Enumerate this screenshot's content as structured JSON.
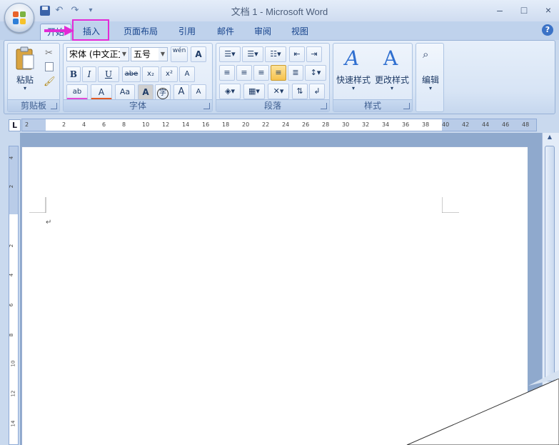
{
  "window": {
    "title": "文档 1 - Microsoft Word",
    "minimize": "–",
    "maximize": "□",
    "close": "×"
  },
  "qat": {
    "undo": "↶",
    "redo": "↷",
    "more": "▾"
  },
  "tabs": [
    {
      "label": "开始"
    },
    {
      "label": "插入"
    },
    {
      "label": "页面布局"
    },
    {
      "label": "引用"
    },
    {
      "label": "邮件"
    },
    {
      "label": "审阅"
    },
    {
      "label": "视图"
    }
  ],
  "help": "?",
  "clipboard": {
    "paste": "粘贴",
    "label": "剪贴板"
  },
  "font": {
    "font_name": "宋体 (中文正文)",
    "font_size": "五号",
    "wen": "wén",
    "a_box": "A",
    "bold": "B",
    "italic": "I",
    "underline": "U",
    "strike": "abe",
    "sub": "x₂",
    "sup": "x²",
    "clear": "A",
    "highlight": "ab",
    "color": "A",
    "case": "Aa",
    "shade": "A",
    "circle": "字",
    "grow": "A",
    "shrink": "A",
    "label": "字体"
  },
  "paragraph": {
    "label": "段落"
  },
  "styles": {
    "quick": "快速样式",
    "change": "更改样式",
    "label": "样式"
  },
  "editing": {
    "label": "编辑"
  },
  "ruler": {
    "h": [
      "2",
      "2",
      "4",
      "6",
      "8",
      "10",
      "12",
      "14",
      "16",
      "18",
      "20",
      "22",
      "24",
      "26",
      "28",
      "30",
      "32",
      "34",
      "36",
      "38",
      "40",
      "42",
      "44",
      "46",
      "48"
    ],
    "v": [
      "4",
      "2",
      "2",
      "4",
      "6",
      "8",
      "10",
      "12",
      "14"
    ]
  },
  "doc": {
    "para_mark": "↵"
  },
  "colors": {
    "highlight_box": "#e22bd6",
    "accent": "#15428b"
  }
}
